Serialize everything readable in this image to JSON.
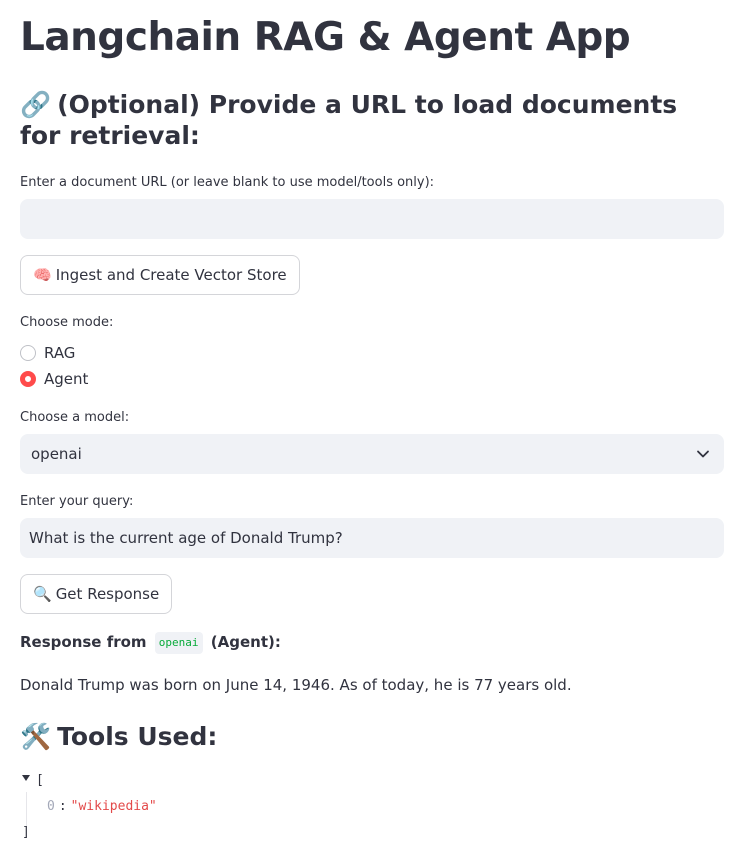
{
  "app": {
    "title": "Langchain RAG & Agent App"
  },
  "url_section": {
    "icon": "link-icon",
    "emoji": "🔗",
    "heading": "(Optional) Provide a URL to load documents for retrieval:",
    "input_label": "Enter a document URL (or leave blank to use model/tools only):",
    "input_value": "",
    "ingest_button": {
      "emoji": "🧠",
      "label": "Ingest and Create Vector Store"
    }
  },
  "mode": {
    "label": "Choose mode:",
    "options": [
      {
        "label": "RAG",
        "selected": false
      },
      {
        "label": "Agent",
        "selected": true
      }
    ]
  },
  "model": {
    "label": "Choose a model:",
    "selected": "openai"
  },
  "query": {
    "label": "Enter your query:",
    "value": "What is the current age of Donald Trump?",
    "button": {
      "emoji": "🔍",
      "label": "Get Response"
    }
  },
  "response": {
    "prefix": "Response from",
    "model": "openai",
    "suffix": "(Agent):",
    "text": "Donald Trump was born on June 14, 1946. As of today, he is 77 years old."
  },
  "tools": {
    "emoji": "🛠️",
    "heading": "Tools Used:",
    "json": {
      "open": "[",
      "close": "]",
      "items": [
        {
          "index": "0",
          "value": "\"wikipedia\""
        }
      ]
    }
  },
  "colors": {
    "accent": "#ff4b4b",
    "text": "#31333f",
    "input_bg": "#f0f2f6",
    "code_green": "#09ab3b",
    "json_string": "#e34a4a"
  }
}
